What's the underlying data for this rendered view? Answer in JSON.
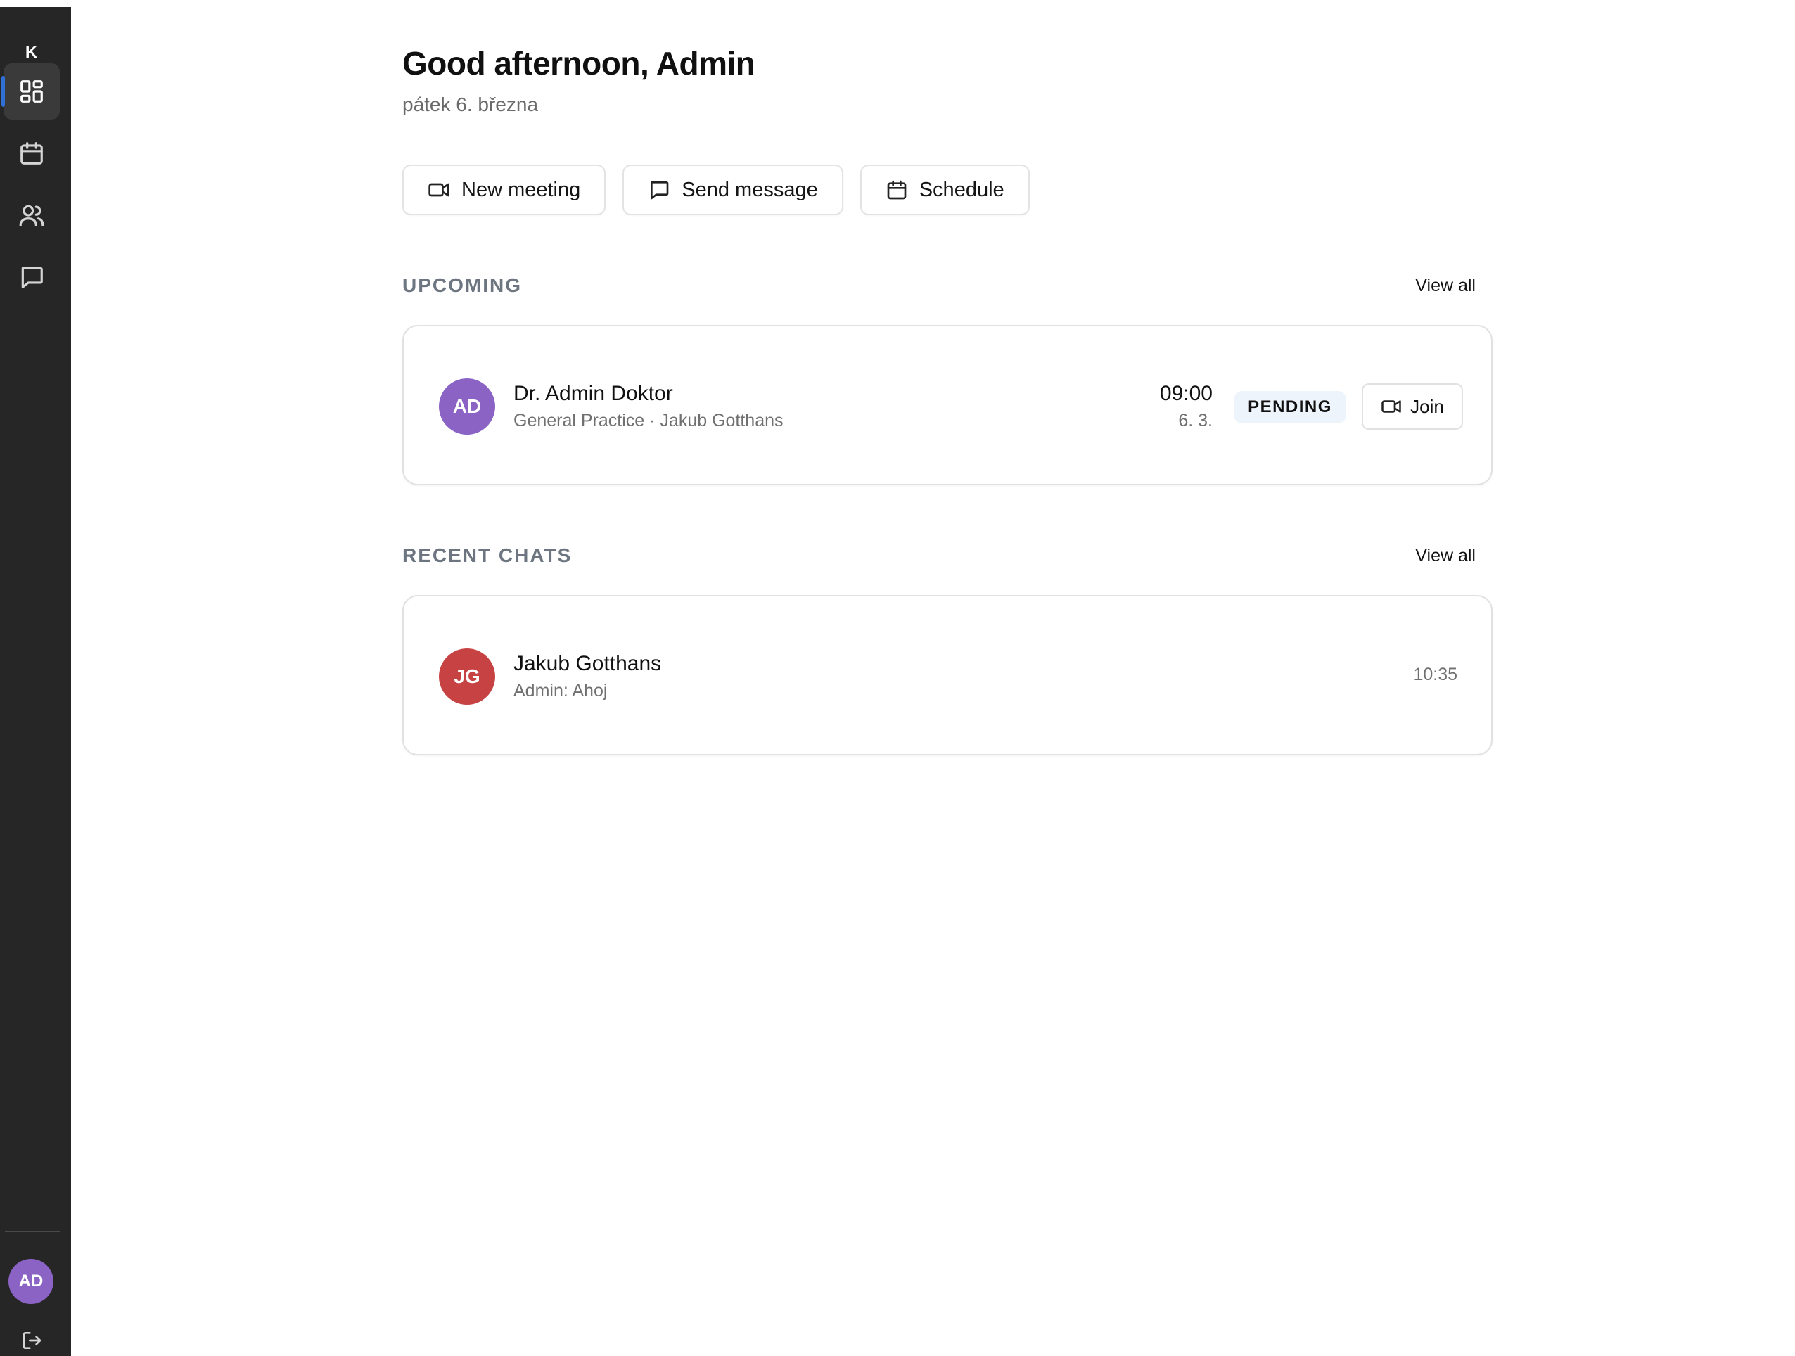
{
  "brand": {
    "initial": "K"
  },
  "sidebar": {
    "items": [
      {
        "name": "dashboard",
        "icon": "dashboard-icon",
        "active": true
      },
      {
        "name": "calendar",
        "icon": "calendar-icon",
        "active": false
      },
      {
        "name": "contacts",
        "icon": "users-icon",
        "active": false
      },
      {
        "name": "chats",
        "icon": "message-icon",
        "active": false
      }
    ],
    "user_initials": "AD",
    "logout_icon": "logout-icon"
  },
  "header": {
    "greeting": "Good afternoon, Admin",
    "date": "pátek 6. března"
  },
  "quick_actions": [
    {
      "label": "New meeting",
      "icon": "video-icon"
    },
    {
      "label": "Send message",
      "icon": "message-icon"
    },
    {
      "label": "Schedule",
      "icon": "calendar-icon"
    }
  ],
  "upcoming": {
    "title": "UPCOMING",
    "view_all": "View all",
    "items": [
      {
        "initials": "AD",
        "name": "Dr. Admin Doktor",
        "detail": "General Practice · Jakub Gotthans",
        "time": "09:00",
        "date": "6. 3.",
        "status": "PENDING",
        "join_label": "Join"
      }
    ]
  },
  "recent_chats": {
    "title": "RECENT CHATS",
    "view_all": "View all",
    "items": [
      {
        "initials": "JG",
        "name": "Jakub Gotthans",
        "preview": "Admin: Ahoj",
        "time": "10:35"
      }
    ]
  },
  "colors": {
    "sidebar_bg": "#262626",
    "active_item_bg": "#3a3a3a",
    "accent_blue": "#2f6fd6",
    "avatar_purple": "#8a63c5",
    "avatar_red": "#c74343",
    "muted_text": "#6d7680",
    "badge_bg": "#eef4fb",
    "card_border": "#e1e1e1"
  }
}
